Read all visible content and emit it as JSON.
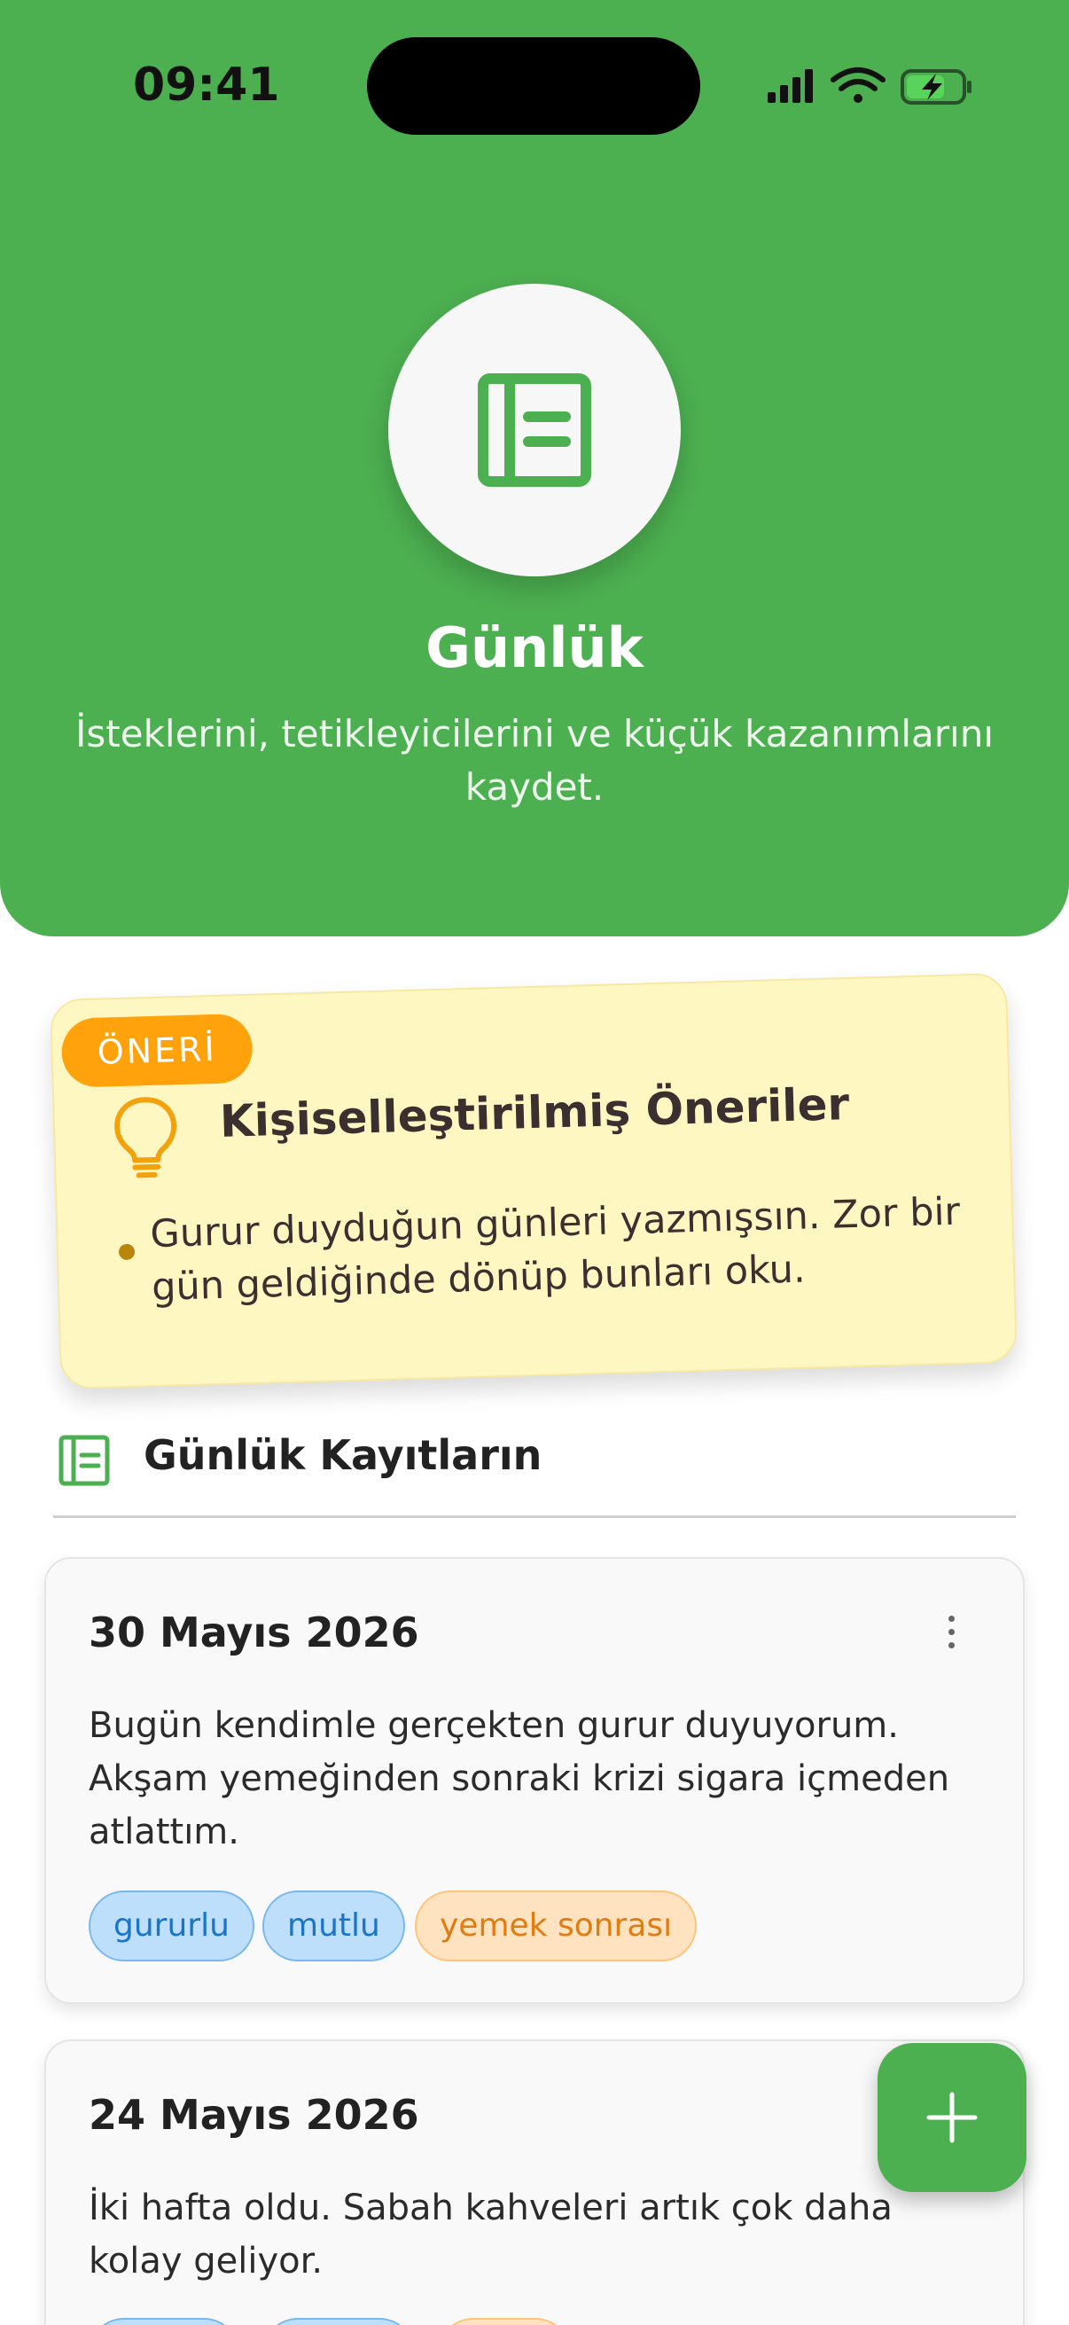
{
  "status_bar": {
    "time": "09:41",
    "icons": [
      "signal-icon",
      "wifi-icon",
      "battery-charging-icon"
    ]
  },
  "header": {
    "icon": "journal-icon",
    "title": "Günlük",
    "subtitle": "İsteklerini, tetikleyicilerini ve küçük kazanımlarını kaydet.",
    "background_color": "#4CAF50"
  },
  "suggestion": {
    "badge": "ÖNERİ",
    "icon": "lightbulb-icon",
    "title": "Kişiselleştirilmiş Öneriler",
    "items": [
      "Gurur duyduğun günleri yazmışsın. Zor bir gün geldiğinde dönüp bunları oku."
    ],
    "background_color": "#FFF7C2",
    "badge_color": "#FFA20B"
  },
  "entries_section": {
    "icon": "journal-icon",
    "title": "Günlük Kayıtların"
  },
  "entries": [
    {
      "date": "30 Mayıs 2026",
      "text": "Bugün kendimle gerçekten gurur duyuyorum. Akşam yemeğinden sonraki krizi sigara içmeden atlattım.",
      "tags": [
        {
          "label": "gururlu",
          "color": "blue"
        },
        {
          "label": "mutlu",
          "color": "blue"
        },
        {
          "label": "yemek sonrası",
          "color": "orange"
        }
      ]
    },
    {
      "date": "24 Mayıs 2026",
      "text": "İki hafta oldu. Sabah kahveleri artık çok daha kolay geliyor.",
      "tags": [
        {
          "label": "",
          "color": "blue"
        },
        {
          "label": "",
          "color": "blue"
        },
        {
          "label": "",
          "color": "orange"
        }
      ]
    }
  ],
  "fab": {
    "icon": "plus-icon",
    "color": "#4CAF50"
  }
}
